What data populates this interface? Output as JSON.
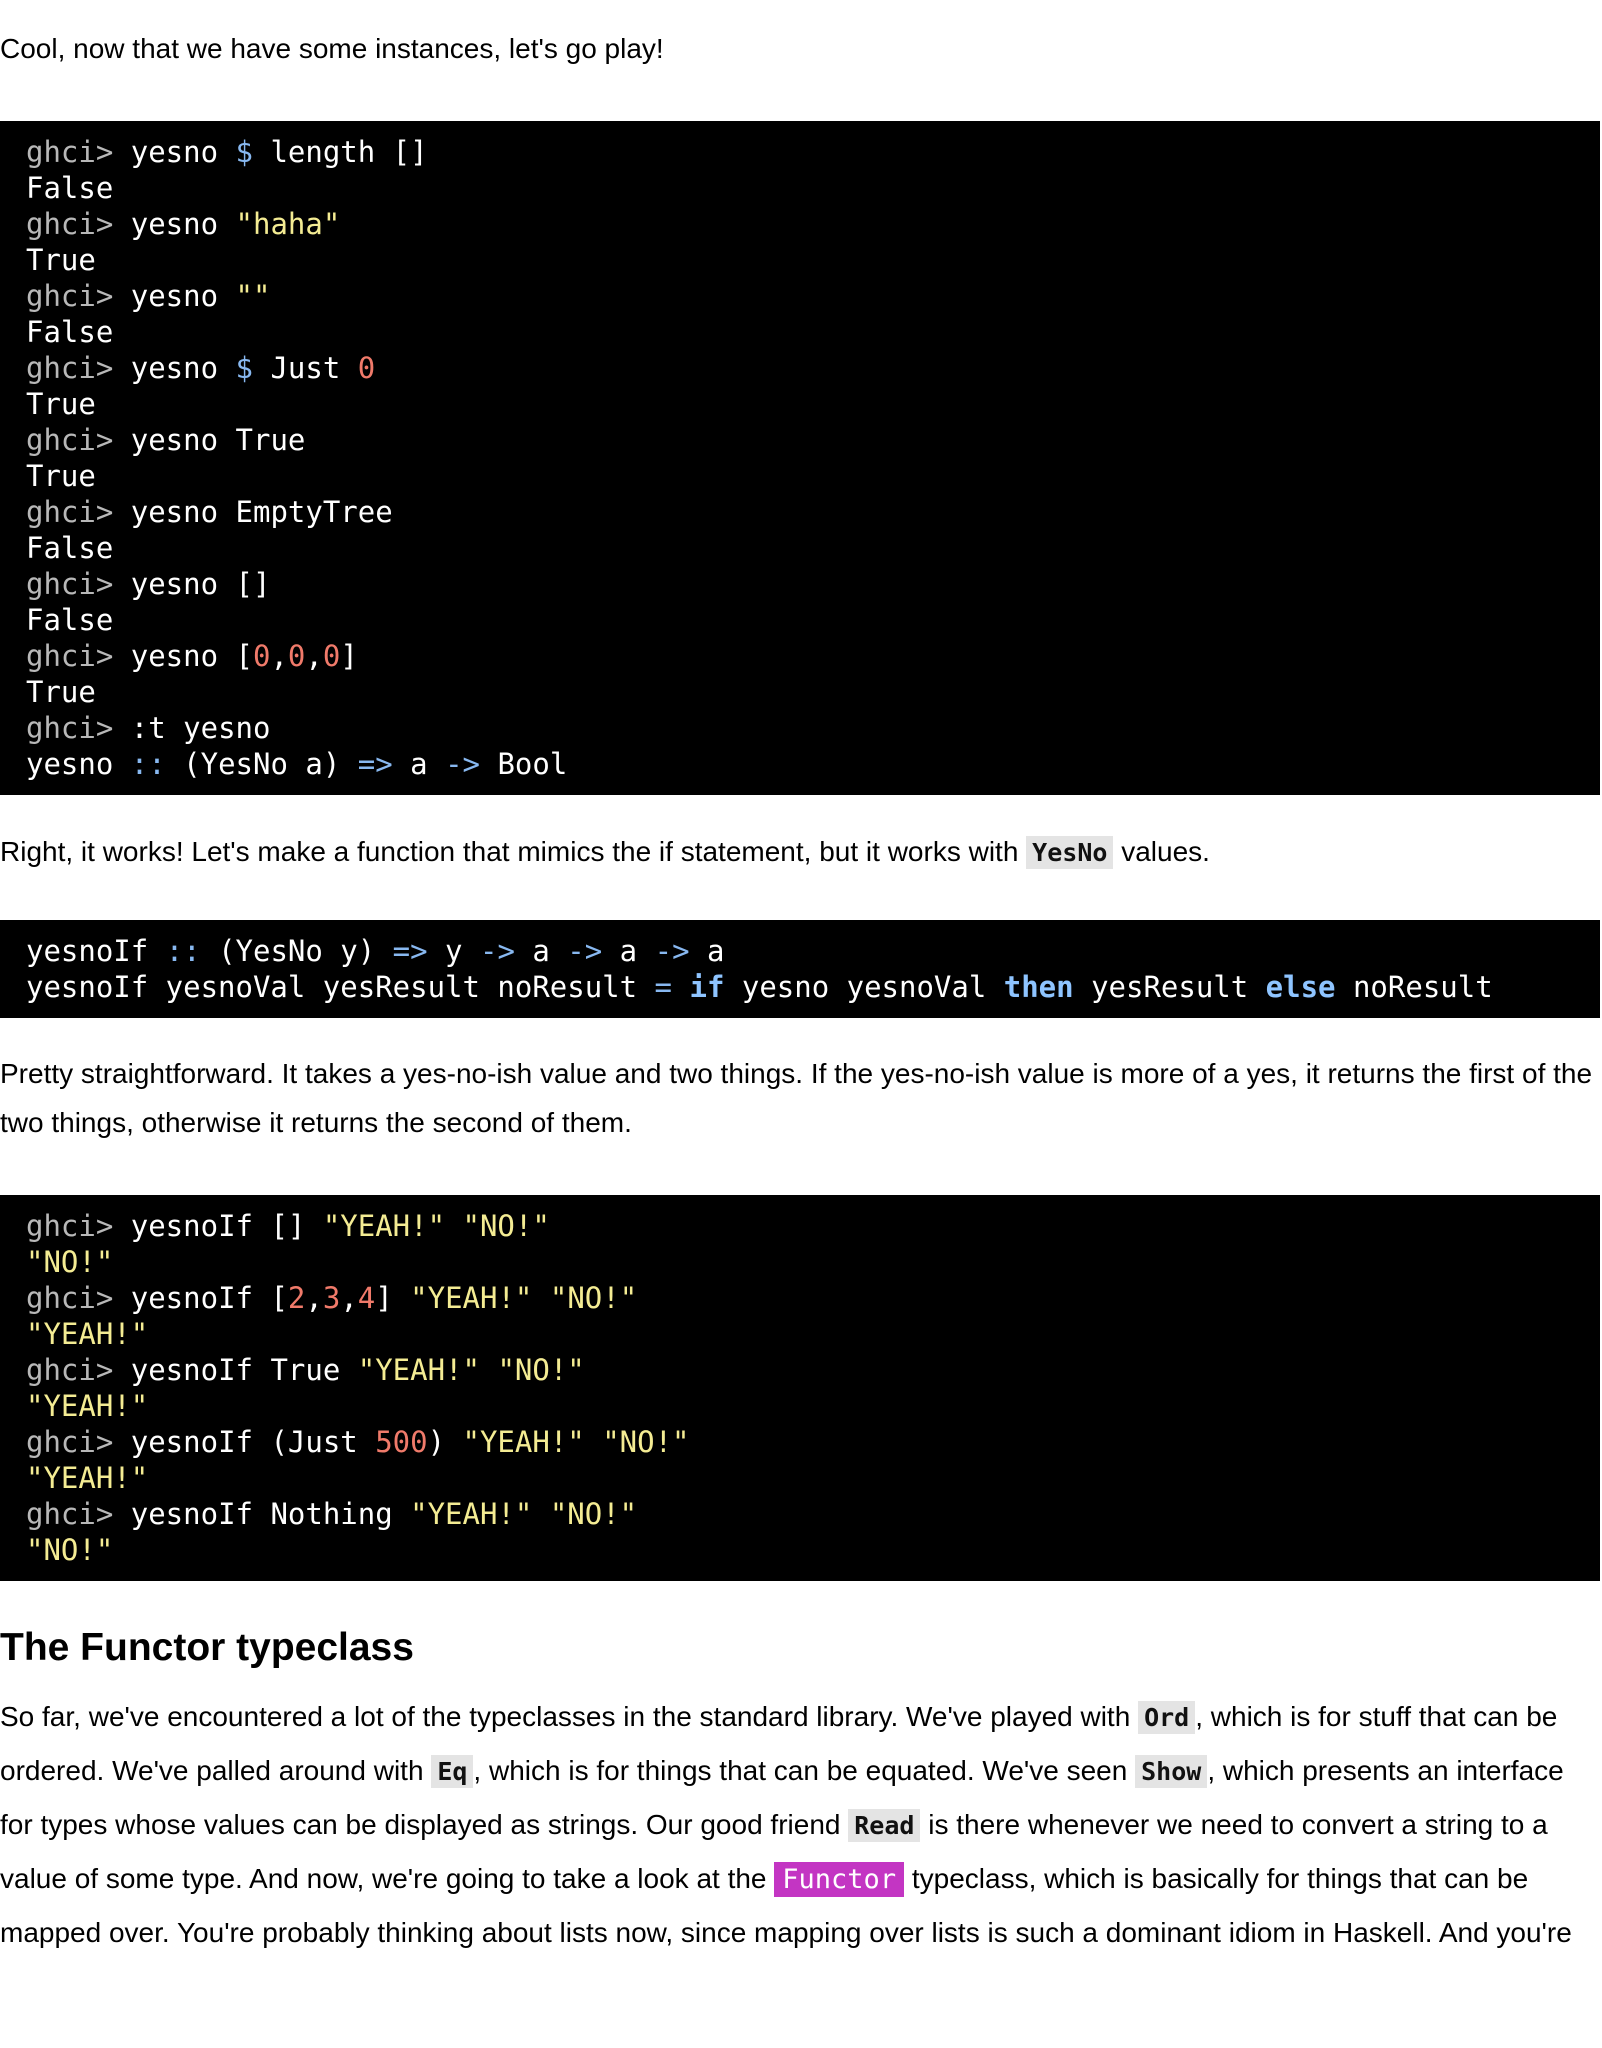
{
  "intro": "Cool, now that we have some instances, let's go play!",
  "block1": [
    [
      [
        "p",
        "ghci> "
      ],
      [
        "t",
        "yesno "
      ],
      [
        "o",
        "$"
      ],
      [
        "t",
        " length []"
      ]
    ],
    [
      [
        "t",
        "False"
      ]
    ],
    [
      [
        "p",
        "ghci> "
      ],
      [
        "t",
        "yesno "
      ],
      [
        "s",
        "\"haha\""
      ]
    ],
    [
      [
        "t",
        "True"
      ]
    ],
    [
      [
        "p",
        "ghci> "
      ],
      [
        "t",
        "yesno "
      ],
      [
        "s",
        "\"\""
      ]
    ],
    [
      [
        "t",
        "False"
      ]
    ],
    [
      [
        "p",
        "ghci> "
      ],
      [
        "t",
        "yesno "
      ],
      [
        "o",
        "$"
      ],
      [
        "t",
        " Just "
      ],
      [
        "n",
        "0"
      ]
    ],
    [
      [
        "t",
        "True"
      ]
    ],
    [
      [
        "p",
        "ghci> "
      ],
      [
        "t",
        "yesno True"
      ]
    ],
    [
      [
        "t",
        "True"
      ]
    ],
    [
      [
        "p",
        "ghci> "
      ],
      [
        "t",
        "yesno EmptyTree"
      ]
    ],
    [
      [
        "t",
        "False"
      ]
    ],
    [
      [
        "p",
        "ghci> "
      ],
      [
        "t",
        "yesno []"
      ]
    ],
    [
      [
        "t",
        "False"
      ]
    ],
    [
      [
        "p",
        "ghci> "
      ],
      [
        "t",
        "yesno ["
      ],
      [
        "n",
        "0"
      ],
      [
        "t",
        ","
      ],
      [
        "n",
        "0"
      ],
      [
        "t",
        ","
      ],
      [
        "n",
        "0"
      ],
      [
        "t",
        "]"
      ]
    ],
    [
      [
        "t",
        "True"
      ]
    ],
    [
      [
        "p",
        "ghci> "
      ],
      [
        "t",
        ":t yesno"
      ]
    ],
    [
      [
        "t",
        "yesno "
      ],
      [
        "o",
        "::"
      ],
      [
        "t",
        " (YesNo a) "
      ],
      [
        "o",
        "=>"
      ],
      [
        "t",
        " a "
      ],
      [
        "o",
        "->"
      ],
      [
        "t",
        " Bool"
      ]
    ]
  ],
  "p2": {
    "before": "Right, it works! Let's make a function that mimics the if statement, but it works with ",
    "code": "YesNo",
    "after": " values."
  },
  "block2": [
    [
      [
        "t",
        "yesnoIf "
      ],
      [
        "o",
        "::"
      ],
      [
        "t",
        " (YesNo y) "
      ],
      [
        "o",
        "=>"
      ],
      [
        "t",
        " y "
      ],
      [
        "o",
        "->"
      ],
      [
        "t",
        " a "
      ],
      [
        "o",
        "->"
      ],
      [
        "t",
        " a "
      ],
      [
        "o",
        "->"
      ],
      [
        "t",
        " a"
      ]
    ],
    [
      [
        "t",
        "yesnoIf yesnoVal yesResult noResult "
      ],
      [
        "o",
        "="
      ],
      [
        "t",
        " "
      ],
      [
        "k",
        "if"
      ],
      [
        "t",
        " yesno yesnoVal "
      ],
      [
        "k",
        "then"
      ],
      [
        "t",
        " yesResult "
      ],
      [
        "k",
        "else"
      ],
      [
        "t",
        " noResult"
      ]
    ]
  ],
  "p3": "Pretty straightforward. It takes a yes-no-ish value and two things. If the yes-no-ish value is more of a yes, it returns the first of the two things, otherwise it returns the second of them.",
  "block3": [
    [
      [
        "p",
        "ghci> "
      ],
      [
        "t",
        "yesnoIf [] "
      ],
      [
        "s",
        "\"YEAH!\""
      ],
      [
        "t",
        " "
      ],
      [
        "s",
        "\"NO!\""
      ]
    ],
    [
      [
        "s",
        "\"NO!\""
      ]
    ],
    [
      [
        "p",
        "ghci> "
      ],
      [
        "t",
        "yesnoIf ["
      ],
      [
        "n",
        "2"
      ],
      [
        "t",
        ","
      ],
      [
        "n",
        "3"
      ],
      [
        "t",
        ","
      ],
      [
        "n",
        "4"
      ],
      [
        "t",
        "] "
      ],
      [
        "s",
        "\"YEAH!\""
      ],
      [
        "t",
        " "
      ],
      [
        "s",
        "\"NO!\""
      ]
    ],
    [
      [
        "s",
        "\"YEAH!\""
      ]
    ],
    [
      [
        "p",
        "ghci> "
      ],
      [
        "t",
        "yesnoIf True "
      ],
      [
        "s",
        "\"YEAH!\""
      ],
      [
        "t",
        " "
      ],
      [
        "s",
        "\"NO!\""
      ]
    ],
    [
      [
        "s",
        "\"YEAH!\""
      ]
    ],
    [
      [
        "p",
        "ghci> "
      ],
      [
        "t",
        "yesnoIf (Just "
      ],
      [
        "n",
        "500"
      ],
      [
        "t",
        ") "
      ],
      [
        "s",
        "\"YEAH!\""
      ],
      [
        "t",
        " "
      ],
      [
        "s",
        "\"NO!\""
      ]
    ],
    [
      [
        "s",
        "\"YEAH!\""
      ]
    ],
    [
      [
        "p",
        "ghci> "
      ],
      [
        "t",
        "yesnoIf Nothing "
      ],
      [
        "s",
        "\"YEAH!\""
      ],
      [
        "t",
        " "
      ],
      [
        "s",
        "\"NO!\""
      ]
    ],
    [
      [
        "s",
        "\"NO!\""
      ]
    ]
  ],
  "heading": "The Functor typeclass",
  "p4": {
    "t1": "So far, we've encountered a lot of the typeclasses in the standard library. We've played with ",
    "c1": "Ord",
    "t2": ", which is for stuff that can be ordered. We've palled around with ",
    "c2": "Eq",
    "t3": ", which is for things that can be equated. We've seen ",
    "c3": "Show",
    "t4": ", which presents an interface for types whose values can be displayed as strings. Our good friend ",
    "c4": "Read",
    "t5": " is there whenever we need to convert a string to a value of some type. And now, we're going to take a look at the ",
    "c5": "Functor",
    "t6": " typeclass, which is basically for things that can be mapped over. You're probably thinking about lists now, since mapping over lists is such a dominant idiom in Haskell. And you're"
  },
  "colors": {
    "code_bg": "#000000",
    "prompt": "#b8b8b8",
    "operator": "#88b8f0",
    "string": "#f4ec93",
    "number": "#f07a6a",
    "keyword": "#8ec4ff",
    "inline_code_bg": "#e4e4e4",
    "highlight_code_bg": "#c335c3"
  }
}
